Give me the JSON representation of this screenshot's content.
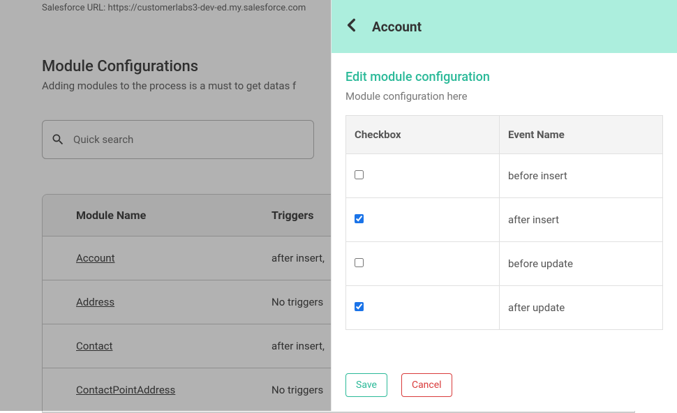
{
  "meta": {
    "url_label": "Salesforce URL:",
    "url_value": "https://customerlabs3-dev-ed.my.salesforce.com"
  },
  "section": {
    "title": "Module Configurations",
    "subtitle": "Adding modules to the process is a must to get datas f"
  },
  "search": {
    "placeholder": "Quick search"
  },
  "module_table": {
    "headers": {
      "name": "Module Name",
      "triggers": "Triggers"
    },
    "rows": [
      {
        "name": "Account",
        "triggers": "after insert,"
      },
      {
        "name": "Address",
        "triggers": "No triggers"
      },
      {
        "name": "Contact",
        "triggers": "after insert,"
      },
      {
        "name": "ContactPointAddress",
        "triggers": "No triggers"
      }
    ]
  },
  "panel": {
    "title": "Account",
    "heading": "Edit module configuration",
    "subtitle": "Module configuration here",
    "columns": {
      "checkbox": "Checkbox",
      "event": "Event Name"
    },
    "events": [
      {
        "checked": false,
        "name": "before insert"
      },
      {
        "checked": true,
        "name": "after insert"
      },
      {
        "checked": false,
        "name": "before update"
      },
      {
        "checked": true,
        "name": "after update"
      }
    ],
    "actions": {
      "save": "Save",
      "cancel": "Cancel"
    }
  }
}
